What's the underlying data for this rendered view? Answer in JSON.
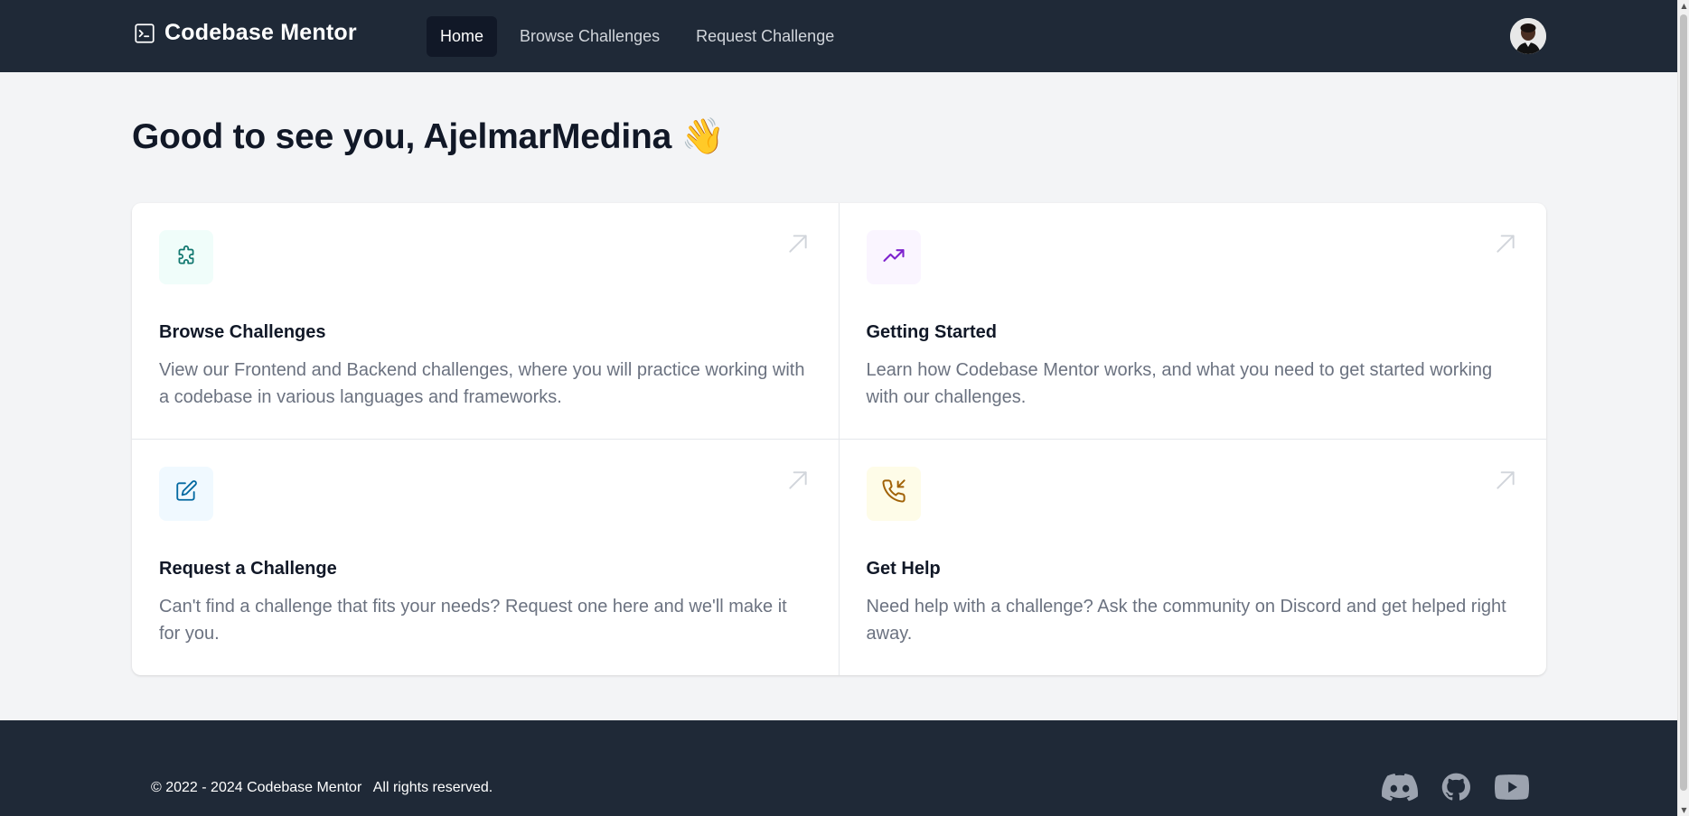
{
  "header": {
    "brand_name": "Codebase Mentor",
    "brand_icon": "terminal-icon",
    "nav": [
      {
        "label": "Home",
        "active": true
      },
      {
        "label": "Browse Challenges",
        "active": false
      },
      {
        "label": "Request Challenge",
        "active": false
      }
    ],
    "avatar_icon": "user-avatar"
  },
  "main": {
    "greeting": "Good to see you, AjelmarMedina 👋",
    "cards": [
      {
        "title": "Browse Challenges",
        "description": "View our Frontend and Backend challenges, where you will practice working with a codebase in various languages and frameworks.",
        "icon": "puzzle-icon",
        "icon_color": "#0f766e",
        "icon_bg": "#f0fdfa"
      },
      {
        "title": "Getting Started",
        "description": "Learn how Codebase Mentor works, and what you need to get started working with our challenges.",
        "icon": "trending-up-icon",
        "icon_color": "#7e22ce",
        "icon_bg": "#faf5ff"
      },
      {
        "title": "Request a Challenge",
        "description": "Can't find a challenge that fits your needs? Request one here and we'll make it for you.",
        "icon": "pencil-square-icon",
        "icon_color": "#0369a1",
        "icon_bg": "#f0f9ff"
      },
      {
        "title": "Get Help",
        "description": "Need help with a challenge? Ask the community on Discord and get helped right away.",
        "icon": "phone-incoming-icon",
        "icon_color": "#a16207",
        "icon_bg": "#fefce8"
      }
    ]
  },
  "footer": {
    "copyright": "© 2022 - 2024 Codebase Mentor",
    "rights": "All rights reserved.",
    "socials": [
      "discord-icon",
      "github-icon",
      "youtube-icon"
    ]
  },
  "colors": {
    "nav_bg": "#1f2937",
    "page_bg": "#f3f4f6",
    "active_nav_bg": "#111827"
  }
}
